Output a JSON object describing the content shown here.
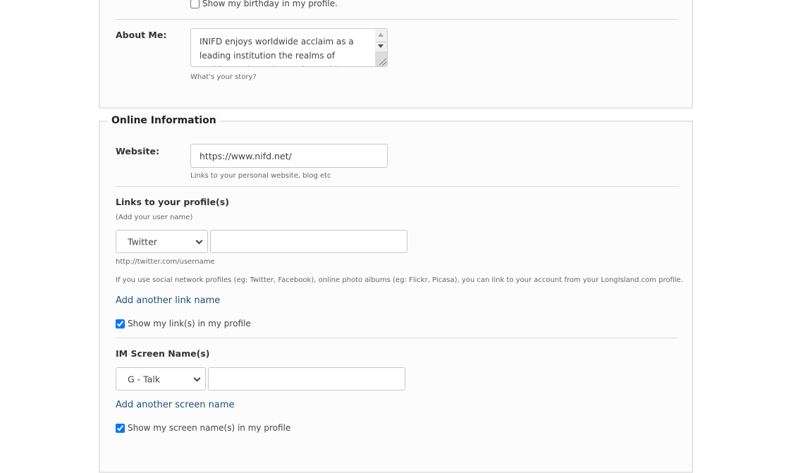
{
  "personal": {
    "show_birthday": {
      "label": "Show my birthday in my profile.",
      "checked": false
    },
    "about_me": {
      "label": "About Me:",
      "value": "INIFD enjoys worldwide acclaim as a leading institution the realms of Fashion and Interior Design. With a legacy of",
      "help": "What's your story?"
    }
  },
  "online": {
    "legend": "Online Information",
    "website": {
      "label": "Website:",
      "value": "https://www.nifd.net/",
      "help": "Links to your personal website, blog etc"
    },
    "links": {
      "heading": "Links to your profile(s)",
      "subheading": "(Add your user name)",
      "service_selected": "Twitter",
      "username_value": "",
      "url_hint": "http://twitter.com/username",
      "description": "If you use social network profiles (eg: Twitter, Facebook), online photo albums (eg: Flickr, Picasa), you can link to your account from your LongIsland.com profile.",
      "add_link": "Add another link name",
      "show_links": {
        "label": "Show my link(s) in my profile",
        "checked": true
      }
    },
    "im": {
      "heading": "IM Screen Name(s)",
      "service_selected": "G - Talk",
      "screen_name_value": "",
      "add_link": "Add another screen name",
      "show_names": {
        "label": "Show my screen name(s) in my profile",
        "checked": true
      }
    }
  },
  "colors": {
    "link": "#1f4e79",
    "checkbox_accent": "#0075ff",
    "fieldset_border": "#e6e6e6",
    "fieldset_bg": "#fcfcfc"
  }
}
